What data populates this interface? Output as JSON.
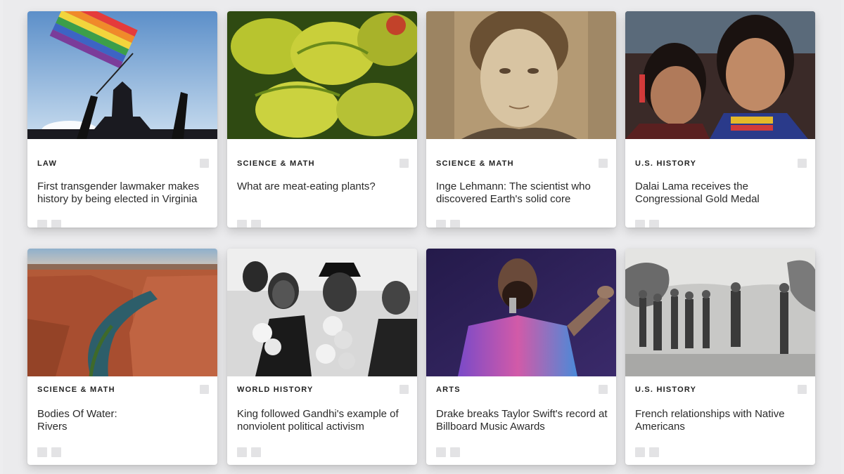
{
  "articles": [
    {
      "category": "LAW",
      "title": "First transgender lawmaker makes history by being elected in Virginia",
      "image": "rainbow-flag-photo"
    },
    {
      "category": "SCIENCE & MATH",
      "title": "What are meat-eating plants?",
      "image": "venus-flytrap-photo"
    },
    {
      "category": "SCIENCE & MATH",
      "title": "Inge Lehmann: The scientist who discovered Earth's solid core",
      "image": "portrait-photo"
    },
    {
      "category": "U.S. HISTORY",
      "title": "Dalai Lama receives the Congressional Gold Medal",
      "image": "children-photo"
    },
    {
      "category": "SCIENCE & MATH",
      "title": "Bodies Of Water:\nRivers",
      "image": "canyon-river-photo"
    },
    {
      "category": "WORLD HISTORY",
      "title": "King followed Gandhi's example of nonviolent political activism",
      "image": "crowd-garlands-photo"
    },
    {
      "category": "ARTS",
      "title": "Drake breaks Taylor Swift's record at Billboard Music Awards",
      "image": "performer-photo"
    },
    {
      "category": "U.S. HISTORY",
      "title": "French relationships with Native Americans",
      "image": "historical-engraving"
    }
  ],
  "colors": {
    "background": "#ebebed",
    "card": "#ffffff",
    "placeholder_icon": "#e3e3e5",
    "text": "#2a2a2a"
  }
}
